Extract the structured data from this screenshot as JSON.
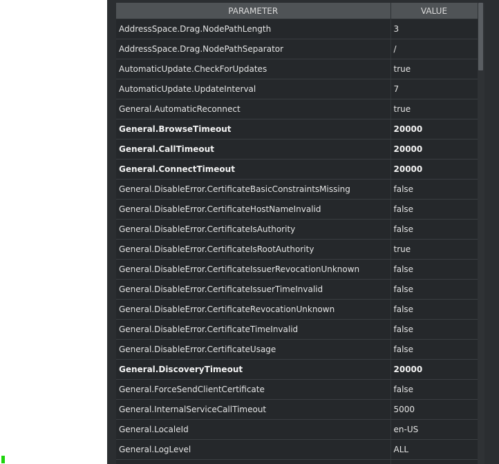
{
  "table": {
    "headers": {
      "parameter": "PARAMETER",
      "value": "VALUE"
    },
    "rows": [
      {
        "parameter": "AddressSpace.Drag.NodePathLength",
        "value": "3",
        "bold": false
      },
      {
        "parameter": "AddressSpace.Drag.NodePathSeparator",
        "value": "/",
        "bold": false
      },
      {
        "parameter": "AutomaticUpdate.CheckForUpdates",
        "value": "true",
        "bold": false
      },
      {
        "parameter": "AutomaticUpdate.UpdateInterval",
        "value": "7",
        "bold": false
      },
      {
        "parameter": "General.AutomaticReconnect",
        "value": "true",
        "bold": false
      },
      {
        "parameter": "General.BrowseTimeout",
        "value": "20000",
        "bold": true
      },
      {
        "parameter": "General.CallTimeout",
        "value": "20000",
        "bold": true
      },
      {
        "parameter": "General.ConnectTimeout",
        "value": "20000",
        "bold": true
      },
      {
        "parameter": "General.DisableError.CertificateBasicConstraintsMissing",
        "value": "false",
        "bold": false
      },
      {
        "parameter": "General.DisableError.CertificateHostNameInvalid",
        "value": "false",
        "bold": false
      },
      {
        "parameter": "General.DisableError.CertificateIsAuthority",
        "value": "false",
        "bold": false
      },
      {
        "parameter": "General.DisableError.CertificateIsRootAuthority",
        "value": "true",
        "bold": false
      },
      {
        "parameter": "General.DisableError.CertificateIssuerRevocationUnknown",
        "value": "false",
        "bold": false
      },
      {
        "parameter": "General.DisableError.CertificateIssuerTimeInvalid",
        "value": "false",
        "bold": false
      },
      {
        "parameter": "General.DisableError.CertificateRevocationUnknown",
        "value": "false",
        "bold": false
      },
      {
        "parameter": "General.DisableError.CertificateTimeInvalid",
        "value": "false",
        "bold": false
      },
      {
        "parameter": "General.DisableError.CertificateUsage",
        "value": "false",
        "bold": false
      },
      {
        "parameter": "General.DiscoveryTimeout",
        "value": "20000",
        "bold": true
      },
      {
        "parameter": "General.ForceSendClientCertificate",
        "value": "false",
        "bold": false
      },
      {
        "parameter": "General.InternalServiceCallTimeout",
        "value": "5000",
        "bold": false
      },
      {
        "parameter": "General.LocaleId",
        "value": "en-US",
        "bold": false
      },
      {
        "parameter": "General.LogLevel",
        "value": "ALL",
        "bold": false
      },
      {
        "parameter": "",
        "value": "",
        "bold": false
      }
    ]
  }
}
